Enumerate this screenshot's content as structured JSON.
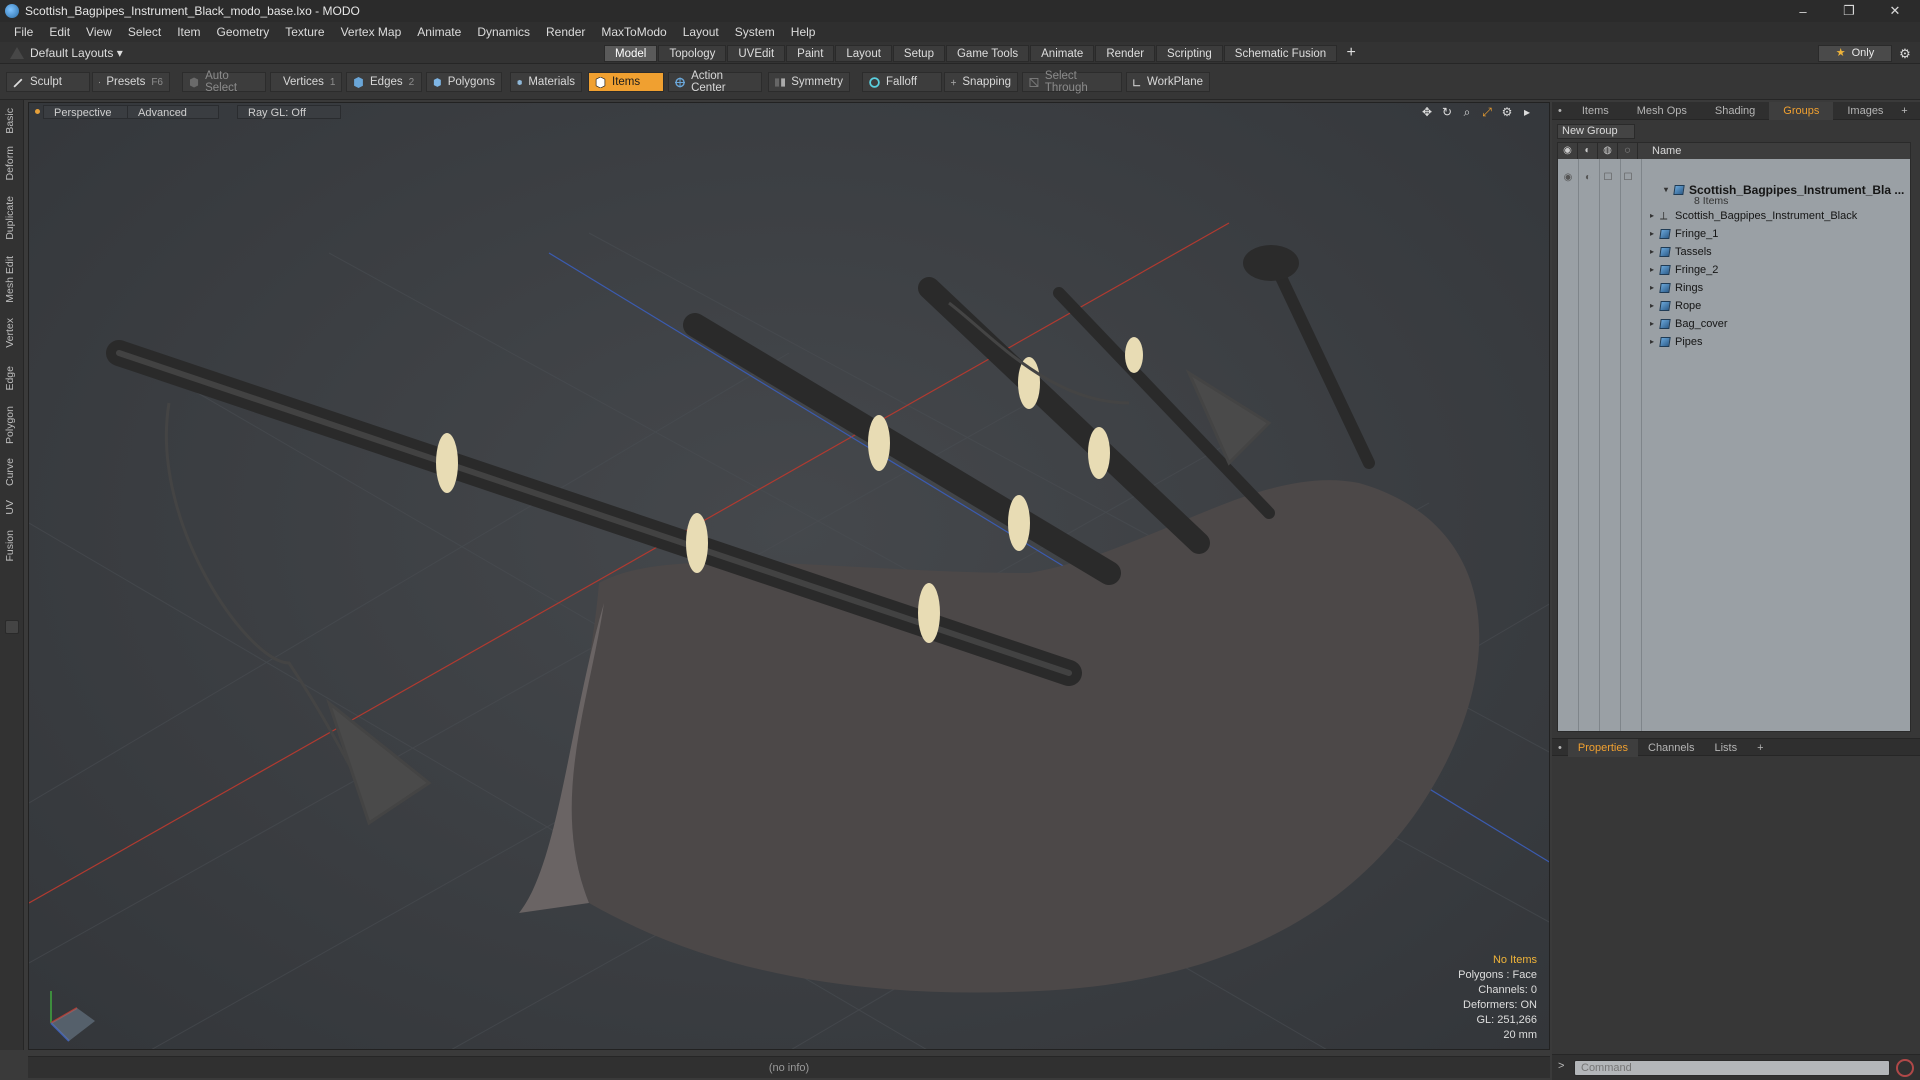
{
  "window": {
    "title": "Scottish_Bagpipes_Instrument_Black_modo_base.lxo - MODO",
    "controls": [
      "–",
      "❐",
      "✕"
    ]
  },
  "menu": [
    "File",
    "Edit",
    "View",
    "Select",
    "Item",
    "Geometry",
    "Texture",
    "Vertex Map",
    "Animate",
    "Dynamics",
    "Render",
    "MaxToModo",
    "Layout",
    "System",
    "Help"
  ],
  "layout_dropdown": "Default Layouts ▾",
  "tabs": [
    {
      "label": "Model",
      "active": true
    },
    {
      "label": "Topology"
    },
    {
      "label": "UVEdit"
    },
    {
      "label": "Paint"
    },
    {
      "label": "Layout"
    },
    {
      "label": "Setup"
    },
    {
      "label": "Game Tools"
    },
    {
      "label": "Animate"
    },
    {
      "label": "Render"
    },
    {
      "label": "Scripting"
    },
    {
      "label": "Schematic Fusion"
    }
  ],
  "tab_add": "+",
  "only_label": "Only",
  "toolbar": {
    "sculpt": "Sculpt",
    "presets": "Presets",
    "presets_key": "F6",
    "auto_select": "Auto Select",
    "vertices": "Vertices",
    "vertices_key": "1",
    "edges": "Edges",
    "edges_key": "2",
    "polygons": "Polygons",
    "materials": "Materials",
    "items": "Items",
    "action_center": "Action Center",
    "symmetry": "Symmetry",
    "falloff": "Falloff",
    "snapping": "Snapping",
    "select_through": "Select Through",
    "workplane": "WorkPlane"
  },
  "left_tabs": [
    "Basic",
    "Deform",
    "Duplicate",
    "Mesh Edit",
    "Vertex",
    "Edge",
    "Polygon",
    "Curve",
    "UV",
    "Fusion"
  ],
  "viewport": {
    "view": "Perspective",
    "shading": "Advanced",
    "raygl": "Ray GL: Off",
    "info": {
      "selection": "No Items",
      "polygons": "Polygons : Face",
      "channels": "Channels: 0",
      "deformers": "Deformers: ON",
      "gl": "GL: 251,266",
      "scale": "20 mm"
    }
  },
  "status": "(no info)",
  "right_tabs": [
    {
      "label": "Items"
    },
    {
      "label": "Mesh Ops"
    },
    {
      "label": "Shading"
    },
    {
      "label": "Groups",
      "active": true
    },
    {
      "label": "Images"
    }
  ],
  "new_group": "New Group",
  "outliner": {
    "name_header": "Name",
    "root": {
      "label": "Scottish_Bagpipes_Instrument_Bla ...",
      "count": "8 Items"
    },
    "children": [
      {
        "label": "Scottish_Bagpipes_Instrument_Black",
        "icon": "locator-icon"
      },
      {
        "label": "Fringe_1",
        "icon": "mesh-icon"
      },
      {
        "label": "Tassels",
        "icon": "mesh-icon"
      },
      {
        "label": "Fringe_2",
        "icon": "mesh-icon"
      },
      {
        "label": "Rings",
        "icon": "mesh-icon"
      },
      {
        "label": "Rope",
        "icon": "mesh-icon"
      },
      {
        "label": "Bag_cover",
        "icon": "mesh-icon"
      },
      {
        "label": "Pipes",
        "icon": "mesh-icon"
      }
    ]
  },
  "props_tabs": [
    {
      "label": "Properties",
      "active": true
    },
    {
      "label": "Channels"
    },
    {
      "label": "Lists"
    }
  ],
  "command": {
    "placeholder": "Command"
  },
  "colors": {
    "accent": "#f0a030",
    "highlight": "#f0b43a",
    "axis_x": "#c0392b",
    "axis_z": "#3b5bb0"
  }
}
